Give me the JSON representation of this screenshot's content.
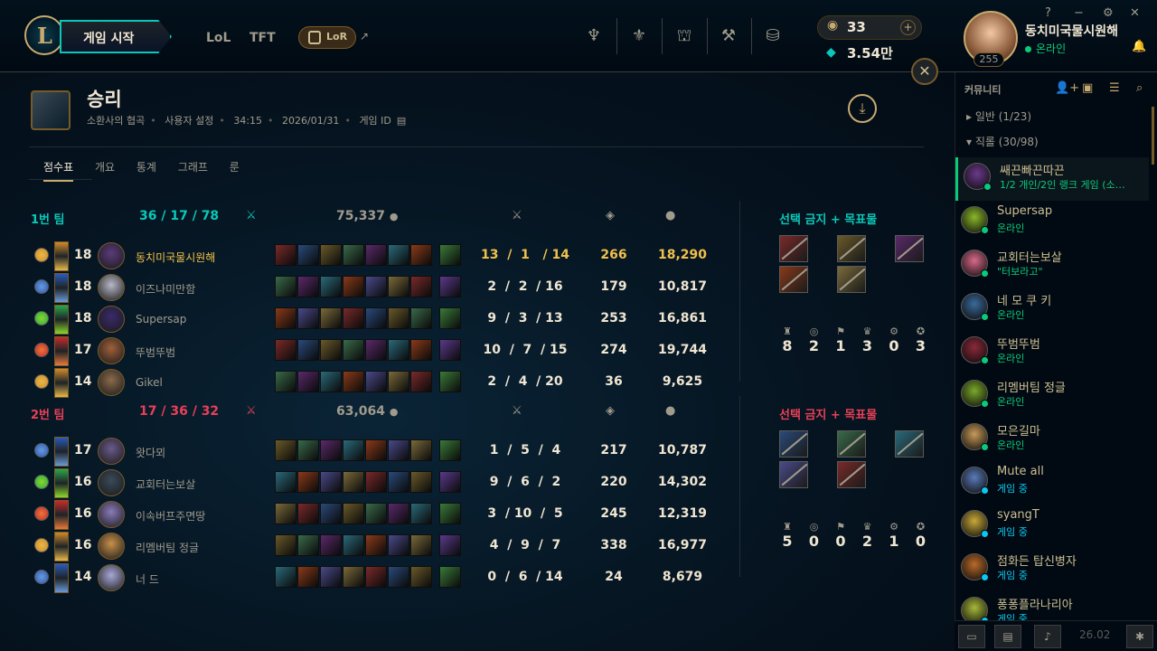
{
  "topbar": {
    "play_label": "게임 시작",
    "nav": [
      "LoL",
      "TFT"
    ],
    "lor_label": "LoR",
    "rp": "33",
    "be": "3.54만",
    "profile_name": "동치미국물시원해",
    "profile_status": "온라인",
    "level": "255",
    "win_controls": [
      "?",
      "−",
      "⚙",
      "✕"
    ]
  },
  "match": {
    "result": "승리",
    "map": "소환사의 협곡",
    "mode": "사용자 설정",
    "duration": "34:15",
    "date": "2026/01/31",
    "game_id_label": "게임 ID"
  },
  "tabs": [
    "점수표",
    "개요",
    "통계",
    "그래프",
    "룬"
  ],
  "teams": [
    {
      "name": "1번 팀",
      "kda": "36  /  17  /  78",
      "gold": "75,337",
      "color": "#0ac8b9",
      "bans_label": "선택 금지 + 목표물",
      "objectives": [
        "8",
        "2",
        "1",
        "3",
        "0",
        "3"
      ],
      "players": [
        {
          "level": "18",
          "name": "동치미국물시원해",
          "kda": "13  /  1   / 14",
          "cs": "266",
          "gold": "18,290",
          "me": true,
          "champ": "#5a3b7a"
        },
        {
          "level": "18",
          "name": "이즈나미만함",
          "kda": "2  /  2  / 16",
          "cs": "179",
          "gold": "10,817",
          "me": false,
          "champ": "#b8b8c8"
        },
        {
          "level": "18",
          "name": "Supersap",
          "kda": "9  /  3  / 13",
          "cs": "253",
          "gold": "16,861",
          "me": false,
          "champ": "#3a2a6a"
        },
        {
          "level": "17",
          "name": "뚜범뚜범",
          "kda": "10  /  7  / 15",
          "cs": "274",
          "gold": "19,744",
          "me": false,
          "champ": "#a0603a"
        },
        {
          "level": "14",
          "name": "Gikel",
          "kda": "2  /  4  / 20",
          "cs": "36",
          "gold": "9,625",
          "me": false,
          "champ": "#8a6a4a"
        }
      ]
    },
    {
      "name": "2번 팀",
      "kda": "17  /  36  /  32",
      "gold": "63,064",
      "color": "#e84057",
      "bans_label": "선택 금지 + 목표물",
      "objectives": [
        "5",
        "0",
        "0",
        "2",
        "1",
        "0"
      ],
      "players": [
        {
          "level": "17",
          "name": "왓다뫼",
          "kda": "1  /  5  /  4",
          "cs": "217",
          "gold": "10,787",
          "me": false,
          "champ": "#6a5a8a"
        },
        {
          "level": "16",
          "name": "교회터는보살",
          "kda": "9  /  6  /  2",
          "cs": "220",
          "gold": "14,302",
          "me": false,
          "champ": "#3a4a5a"
        },
        {
          "level": "16",
          "name": "이속버프주면땅",
          "kda": "3  / 10  /  5",
          "cs": "245",
          "gold": "12,319",
          "me": false,
          "champ": "#8a7ab8"
        },
        {
          "level": "16",
          "name": "리멤버팀 정글",
          "kda": "4  /  9  /  7",
          "cs": "338",
          "gold": "16,977",
          "me": false,
          "champ": "#c8904a"
        },
        {
          "level": "14",
          "name": "너 드",
          "kda": "0  /  6  / 14",
          "cs": "24",
          "gold": "8,679",
          "me": false,
          "champ": "#a8a8d8"
        }
      ]
    }
  ],
  "social": {
    "title": "커뮤니티",
    "general": "일반 (1/23)",
    "friends_group": "직롤 (30/98)",
    "friends": [
      {
        "name": "쌔끈빠끈따끈",
        "status": "1/2 개인/2인 랭크 게임 (소…",
        "color": "#0acb7a",
        "sel": true
      },
      {
        "name": "Supersap",
        "status": "온라인",
        "color": "#0acb7a"
      },
      {
        "name": "교회터는보살",
        "status": "\"터보라고\"",
        "color": "#0acb7a"
      },
      {
        "name": "네 모 쿠 키",
        "status": "온라인",
        "color": "#0acb7a"
      },
      {
        "name": "뚜범뚜범",
        "status": "온라인",
        "color": "#0acb7a"
      },
      {
        "name": "리멤버팀 정글",
        "status": "온라인",
        "color": "#0acb7a"
      },
      {
        "name": "모은길마",
        "status": "온라인",
        "color": "#0acb7a"
      },
      {
        "name": "Mute all",
        "status": "게임 중",
        "color": "#0ac8ef"
      },
      {
        "name": "syangT",
        "status": "게임 중",
        "color": "#0ac8ef"
      },
      {
        "name": "점화든 탑신병자",
        "status": "게임 중",
        "color": "#0ac8ef"
      },
      {
        "name": "퐁퐁플라나리아",
        "status": "게임 중",
        "color": "#0ac8ef"
      }
    ],
    "version": "26.02"
  }
}
